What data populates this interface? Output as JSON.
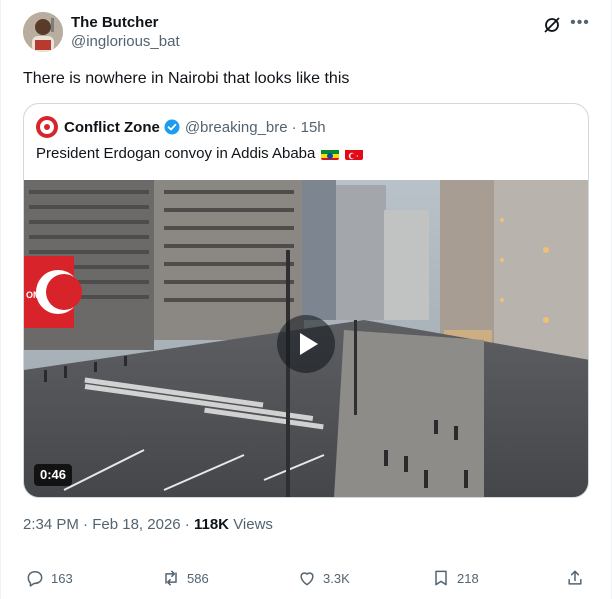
{
  "author": {
    "display_name": "The Butcher",
    "handle": "@inglorious_bat"
  },
  "tweet_text": "There is nowhere in Nairobi that looks like this",
  "quote": {
    "display_name": "Conflict Zone",
    "handle": "@breaking_bre",
    "separator": "·",
    "time": "15h",
    "text": "President Erdogan convoy in Addis Ababa",
    "flags": [
      "ethiopia-flag-icon",
      "turkey-flag-icon"
    ],
    "video_duration": "0:46",
    "billboard_text": "OME"
  },
  "meta": {
    "time": "2:34 PM",
    "separator": "·",
    "date": "Feb 18, 2026",
    "separator2": "·",
    "views_count": "118K",
    "views_label": "Views"
  },
  "actions": {
    "replies": "163",
    "reposts": "586",
    "likes": "3.3K",
    "bookmarks": "218"
  },
  "colors": {
    "text": "#0f1419",
    "secondary": "#536471",
    "border": "#cfd9de",
    "verified": "#1d9bf0"
  }
}
